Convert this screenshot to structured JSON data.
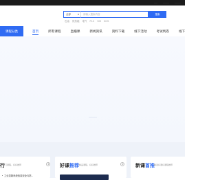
{
  "topbar": {
    "links": [
      "·····",
      "·········",
      "·········"
    ]
  },
  "search": {
    "select_label": "全部",
    "placeholder": "请输入搜索内容",
    "button_label": "搜索",
    "hotwords": [
      "石油",
      "供热能",
      "电气",
      "PLC",
      "SIS",
      "DCS"
    ]
  },
  "nav": {
    "category_label": "课程分类",
    "items": [
      "首页",
      "所有课程",
      "直播课",
      "新闻资讯",
      "资料下载",
      "线下活动",
      "考试判卷",
      "线下"
    ]
  },
  "cards": [
    {
      "title_prefix": "行",
      "title_hl": "",
      "subtitle": "热门课程，好好推荐",
      "item": "工业控制系统信息安全与防..."
    },
    {
      "title_prefix": "好课",
      "title_hl": "推荐",
      "subtitle": "精品课程，好好推荐"
    },
    {
      "title_prefix": "新课",
      "title_hl": "首推",
      "subtitle": "精选好课好课程推荐"
    }
  ],
  "colors": {
    "accent": "#2f6bf3",
    "topbar": "#1b1b1b",
    "banner_bg": "#f5f8fd",
    "lower_bg": "#eef2f9"
  }
}
